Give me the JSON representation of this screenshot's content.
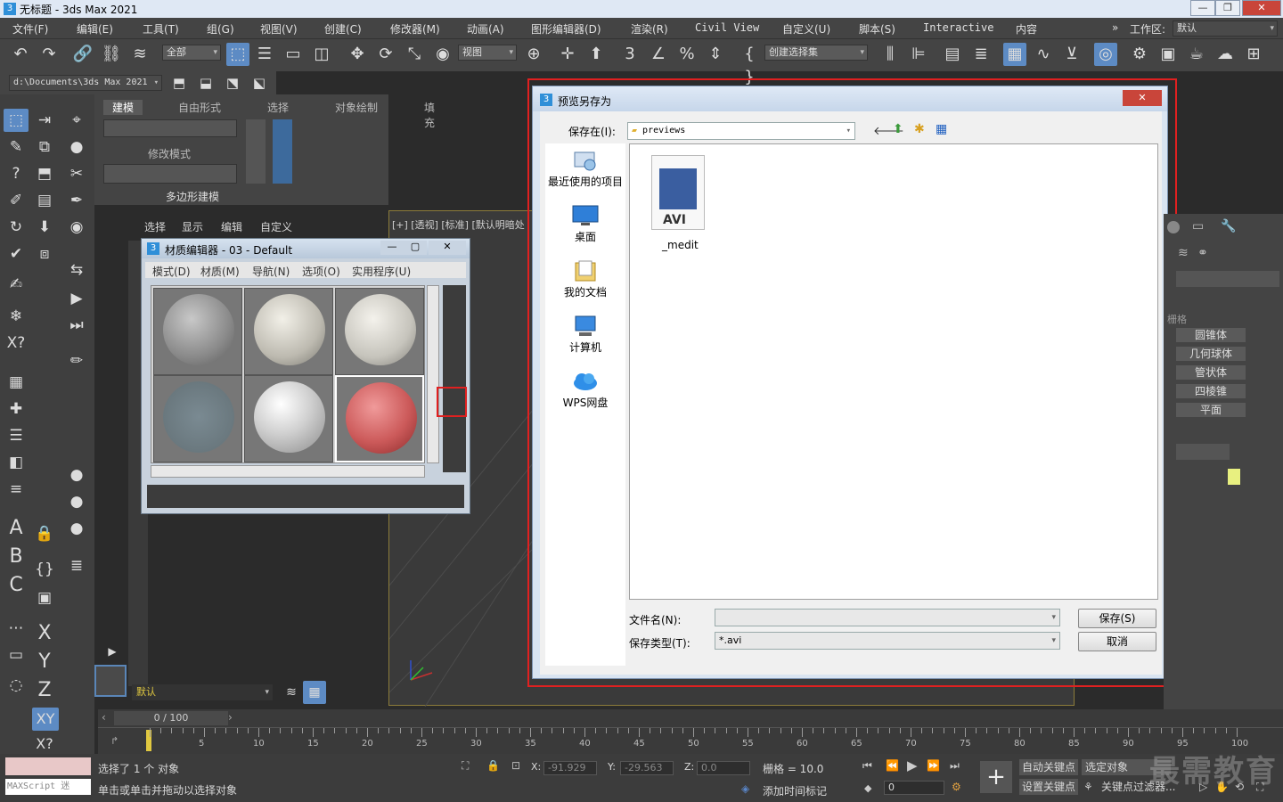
{
  "window": {
    "title": "无标题 - 3ds Max 2021",
    "app_icon": "3"
  },
  "menubar": {
    "items": [
      "文件(F)",
      "编辑(E)",
      "工具(T)",
      "组(G)",
      "视图(V)",
      "创建(C)",
      "修改器(M)",
      "动画(A)",
      "图形编辑器(D)",
      "渲染(R)",
      "Civil View",
      "自定义(U)",
      "脚本(S)",
      "Interactive",
      "内容"
    ],
    "workspace_label": "工作区:",
    "workspace_value": "默认"
  },
  "toolbar": {
    "filter_value": "全部",
    "refcoord_value": "视图",
    "selection_set_placeholder": "创建选择集"
  },
  "pathbar": {
    "project_path": "d:\\Documents\\3ds Max 2021"
  },
  "ribbon": {
    "tabs": [
      "建模",
      "自由形式",
      "选择",
      "对象绘制",
      "填充"
    ],
    "modify_mode": "修改模式",
    "poly_modeling": "多边形建模"
  },
  "scene_explorer": {
    "menus": [
      "选择",
      "显示",
      "编辑",
      "自定义"
    ],
    "layer_value": "默认"
  },
  "viewport": {
    "label": "[+] [透视] [标准] [默认明暗处"
  },
  "material_editor": {
    "title": "材质编辑器 - 03 - Default",
    "menus": [
      "模式(D)",
      "材质(M)",
      "导航(N)",
      "选项(O)",
      "实用程序(U)"
    ]
  },
  "save_dialog": {
    "title": "预览另存为",
    "save_in_label": "保存在(I):",
    "save_in_value": "previews",
    "places": [
      "最近使用的项目",
      "桌面",
      "我的文档",
      "计算机",
      "WPS网盘"
    ],
    "file": {
      "type_badge": "AVI",
      "name": "_medit"
    },
    "filename_label": "文件名(N):",
    "filename_value": "",
    "filetype_label": "保存类型(T):",
    "filetype_value": "*.avi",
    "save_button": "保存(S)",
    "cancel_button": "取消"
  },
  "command_panel": {
    "section_label": "栅格",
    "buttons": [
      "圆锥体",
      "几何球体",
      "管状体",
      "四棱锥",
      "平面"
    ]
  },
  "timeline": {
    "slider_value": "0 / 100",
    "ticks": [
      "5",
      "10",
      "15",
      "20",
      "25",
      "30",
      "35",
      "40",
      "45",
      "50",
      "55",
      "60",
      "65",
      "70",
      "75",
      "80",
      "85",
      "90",
      "95",
      "100"
    ]
  },
  "status": {
    "maxscript": "MAXScript 迷",
    "selected": "选择了 1 个 对象",
    "prompt": "单击或单击并拖动以选择对象",
    "x_label": "X:",
    "x_value": "-91.929",
    "y_label": "Y:",
    "y_value": "-29.563",
    "z_label": "Z:",
    "z_value": "0.0",
    "grid": "栅格 = 10.0",
    "add_time_tag": "添加时间标记",
    "auto_key": "自动关键点",
    "selected_object": "选定对象",
    "set_key": "设置关键点",
    "key_filters": "关键点过滤器...",
    "frame_value": "0"
  },
  "watermark": "最需教育"
}
